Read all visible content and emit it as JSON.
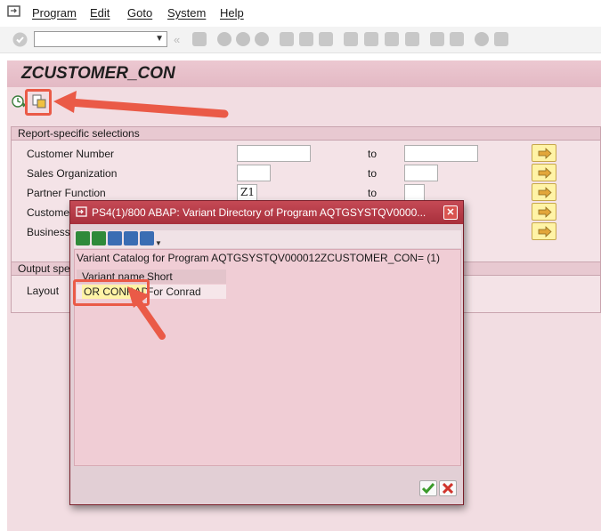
{
  "menubar": {
    "items": [
      "Program",
      "Edit",
      "Goto",
      "System",
      "Help"
    ]
  },
  "screen": {
    "title": "ZCUSTOMER_CON"
  },
  "report_group": {
    "header": "Report-specific selections",
    "to_label": "to",
    "rows": [
      {
        "label": "Customer Number",
        "value": "",
        "to_value": ""
      },
      {
        "label": "Sales Organization",
        "value": "",
        "to_value": ""
      },
      {
        "label": "Partner Function",
        "value": "Z1",
        "to_value": ""
      },
      {
        "label": "Custome",
        "value": "",
        "to_value": ""
      },
      {
        "label": "Business",
        "value": "",
        "to_value": ""
      }
    ]
  },
  "output_group": {
    "header": "Output spe",
    "layout_label": "Layout"
  },
  "dialog": {
    "title": "PS4(1)/800 ABAP: Variant Directory of Program AQTGSYSTQV0000...",
    "catalog_text": "Variant Catalog for Program AQTGSYSTQV000012ZCUSTOMER_CON= (1)",
    "columns": [
      "Variant name",
      "Short Description"
    ],
    "variant": {
      "name": "OR CONRAD",
      "description": "For Conrad"
    }
  },
  "colors": {
    "accent_red": "#ea5a47",
    "dialog_title": "#a8303c",
    "screen_bg": "#f2dde2",
    "highlight_yellow": "#fff3a6"
  },
  "icons": [
    "sap-app-icon",
    "enter-icon",
    "save-icon",
    "back-icon",
    "exit-icon",
    "cancel-icon",
    "print-icon",
    "find-icon",
    "find-next-icon",
    "first-page-icon",
    "previous-page-icon",
    "next-page-icon",
    "last-page-icon",
    "new-session-icon",
    "shortcut-icon",
    "help-icon",
    "customize-icon",
    "execute-icon",
    "get-variant-icon",
    "select-icon",
    "close-icon",
    "continue-icon"
  ]
}
